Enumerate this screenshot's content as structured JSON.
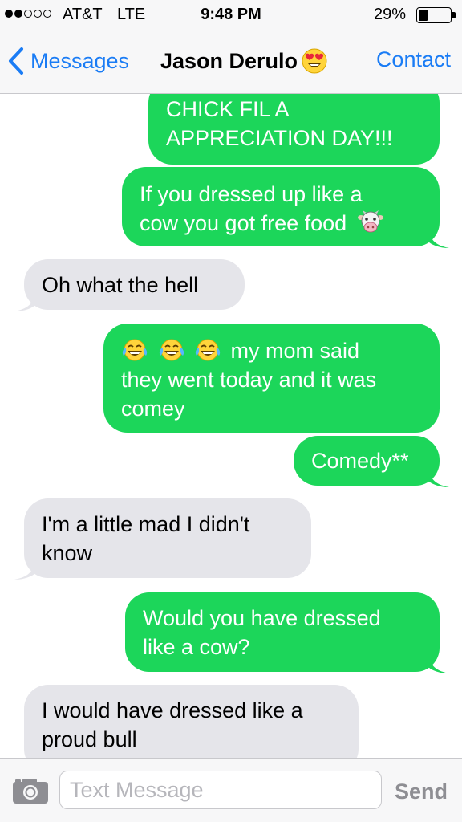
{
  "status_bar": {
    "carrier": "AT&T",
    "network": "LTE",
    "time": "9:48 PM",
    "battery_percent": "29%",
    "battery_level": 0.29,
    "signal_bars": 2,
    "signal_total": 5
  },
  "nav": {
    "back_label": "Messages",
    "title": "Jason Derulo",
    "title_icon": "heart-eyes-emoji-icon",
    "contact_label": "Contact"
  },
  "messages": [
    {
      "from": "me",
      "lines": [
        "CHICK FIL A",
        "APPRECIATION DAY!!!"
      ]
    },
    {
      "from": "me",
      "lines": [
        "If you dressed up like a",
        "cow you got free food"
      ],
      "emoji": "cow-face-icon"
    },
    {
      "from": "them",
      "lines": [
        "Oh what the hell"
      ]
    },
    {
      "from": "me",
      "lines": [
        "my mom said",
        "they went today and it was",
        "comey"
      ],
      "emoji": "tears-of-joy-icon x3"
    },
    {
      "from": "me",
      "lines": [
        "Comedy**"
      ]
    },
    {
      "from": "them",
      "lines": [
        "I'm a little mad I didn't",
        "know"
      ]
    },
    {
      "from": "me",
      "lines": [
        "Would you have dressed",
        "like a cow?"
      ]
    },
    {
      "from": "them",
      "lines": [
        "I would have dressed like a",
        "proud bull"
      ]
    }
  ],
  "input_bar": {
    "placeholder": "Text Message",
    "send_label": "Send",
    "camera_icon": "camera-icon"
  },
  "colors": {
    "sent_bubble": "#1cd65a",
    "received_bubble": "#e5e5ea",
    "ios_blue": "#1a7cf5",
    "bar_background": "#f7f7f8"
  }
}
